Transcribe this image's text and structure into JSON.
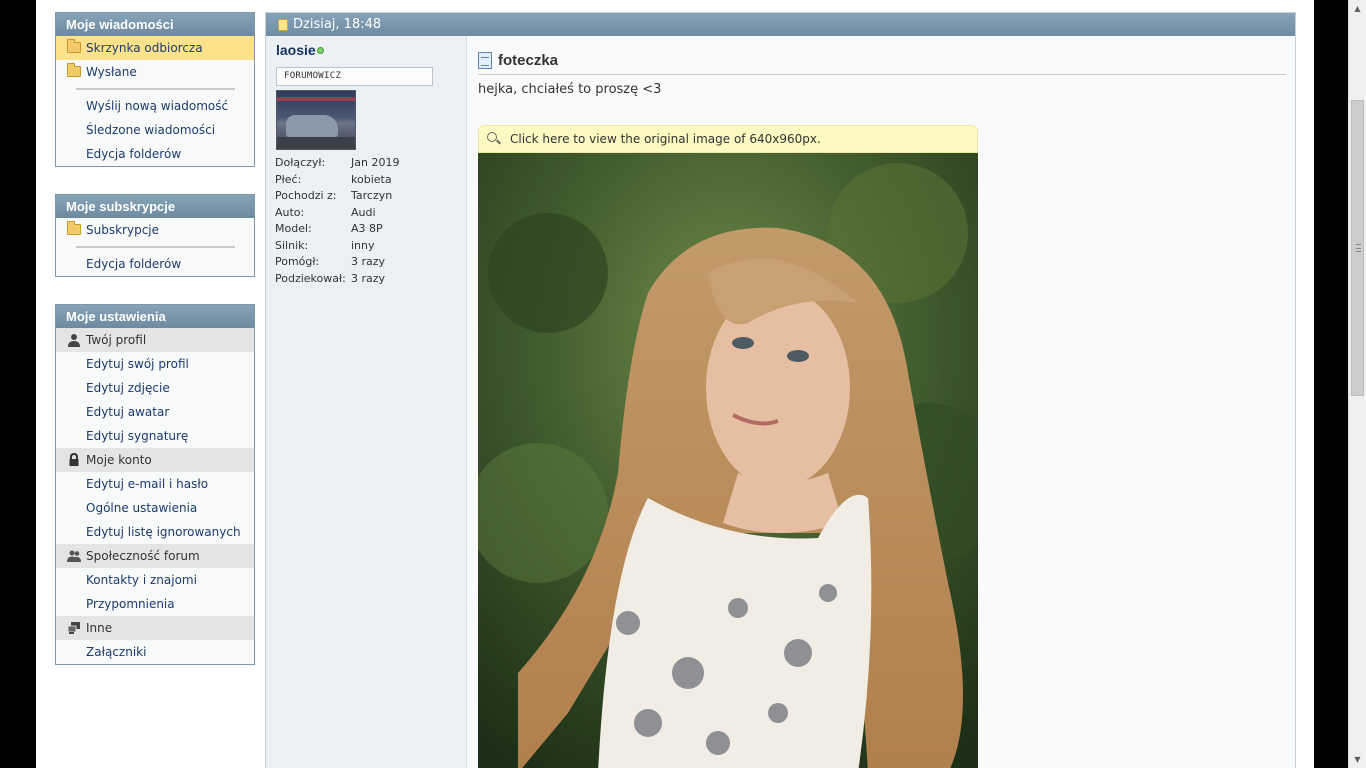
{
  "sidebar": {
    "messages": {
      "header": "Moje wiadomości",
      "folders": [
        "Skrzynka odbiorcza",
        "Wysłane"
      ],
      "links": [
        "Wyślij nową wiadomość",
        "Śledzone wiadomości",
        "Edycja folderów"
      ]
    },
    "subscriptions": {
      "header": "Moje subskrypcje",
      "folders": [
        "Subskrypcje"
      ],
      "links": [
        "Edycja folderów"
      ]
    },
    "settings": {
      "header": "Moje ustawienia",
      "profile": {
        "label": "Twój profil",
        "links": [
          "Edytuj swój profil",
          "Edytuj zdjęcie",
          "Edytuj awatar",
          "Edytuj sygnaturę"
        ]
      },
      "account": {
        "label": "Moje konto",
        "links": [
          "Edytuj e-mail i hasło",
          "Ogólne ustawienia",
          "Edytuj listę ignorowanych"
        ]
      },
      "community": {
        "label": "Społeczność forum",
        "links": [
          "Kontakty i znajomi",
          "Przypomnienia"
        ]
      },
      "other": {
        "label": "Inne",
        "links": [
          "Załączniki"
        ]
      }
    }
  },
  "post": {
    "date": "Dzisiaj, 18:48",
    "author": "laosie",
    "rank": "FORUMOWICZ",
    "facts": [
      {
        "key": "Dołączył:",
        "value": "Jan 2019"
      },
      {
        "key": "Płeć:",
        "value": "kobieta"
      },
      {
        "key": "Pochodzi z:",
        "value": "Tarczyn"
      },
      {
        "key": "Auto:",
        "value": "Audi"
      },
      {
        "key": "Model:",
        "value": "A3 8P"
      },
      {
        "key": "Silnik:",
        "value": "inny"
      },
      {
        "key": "Pomógł:",
        "value": "3 razy"
      },
      {
        "key": "Podziekował:",
        "value": "3 razy"
      }
    ],
    "title": "foteczka",
    "body": "hejka, chciałeś to proszę <3",
    "image_note": "Click here to view the original image of 640x960px."
  },
  "colors": {
    "header": "#7794aa",
    "selected": "#fde28b",
    "link": "#1c3c6e"
  }
}
